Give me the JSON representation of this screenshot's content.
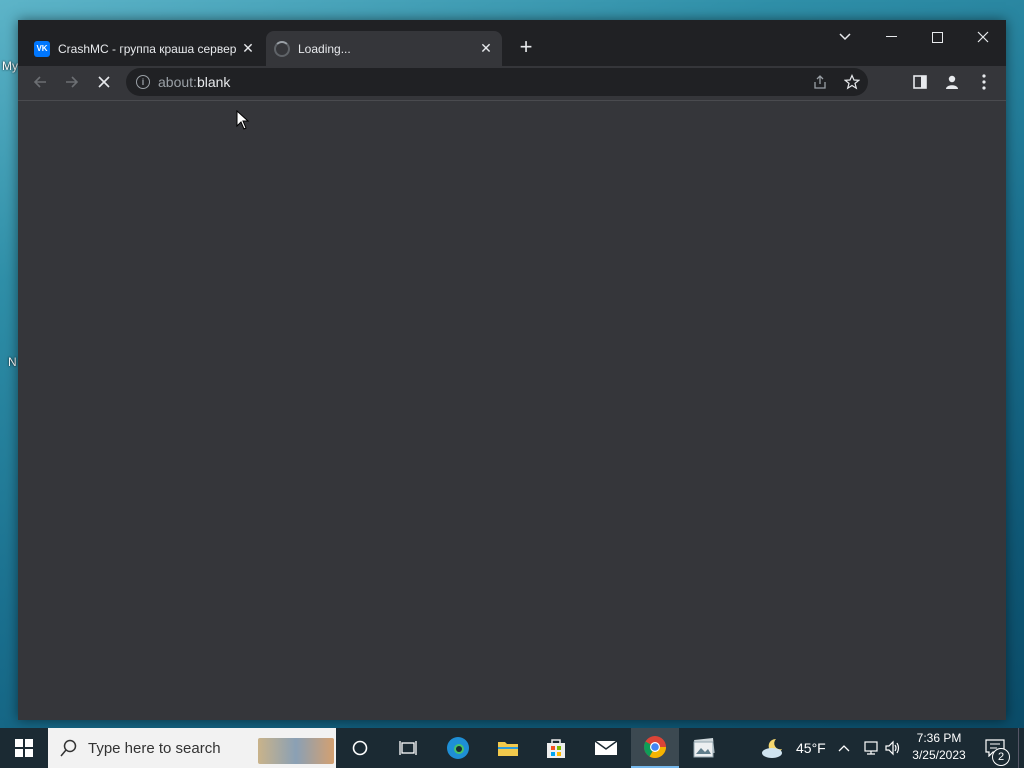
{
  "desktop": {
    "icon_labels": [
      "My",
      "N"
    ]
  },
  "browser": {
    "tabs": [
      {
        "title": "CrashMC - группа краша сервер",
        "favicon": "vk-icon",
        "active": false
      },
      {
        "title": "Loading...",
        "favicon": "loading-spinner",
        "active": true
      }
    ],
    "address": {
      "scheme": "about:",
      "path": "blank"
    },
    "window_controls": [
      "tab-search",
      "minimize",
      "maximize",
      "close"
    ]
  },
  "taskbar": {
    "search_placeholder": "Type here to search",
    "apps": [
      "cortana-icon",
      "task-view-icon",
      "edge-icon",
      "file-explorer-icon",
      "store-icon",
      "mail-icon",
      "chrome-icon",
      "photos-icon"
    ],
    "weather": {
      "temp": "45°F"
    },
    "clock": {
      "time": "7:36 PM",
      "date": "3/25/2023"
    },
    "notifications_count": "2"
  },
  "colors": {
    "accent": "#76b9ed",
    "titlebar": "#202124",
    "page_bg": "#35363a"
  }
}
